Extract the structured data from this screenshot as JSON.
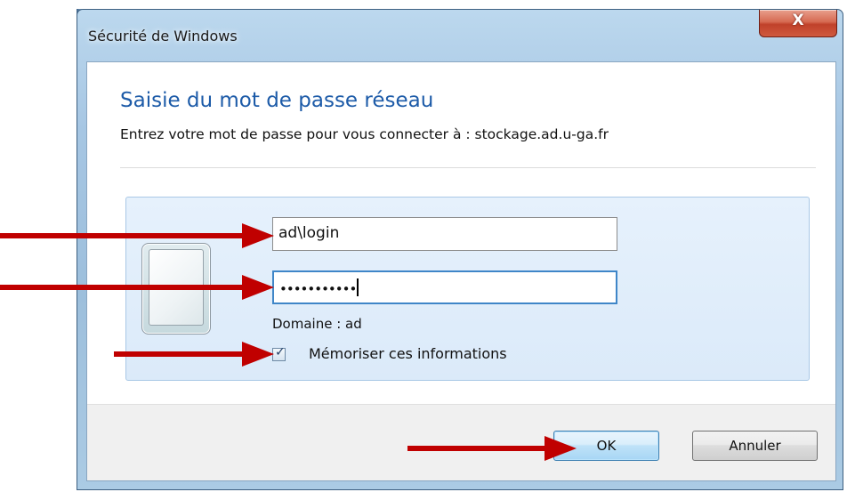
{
  "window": {
    "title": "Sécurité de Windows",
    "close_glyph": "X"
  },
  "dialog": {
    "heading": "Saisie du mot de passe réseau",
    "subheading": "Entrez votre mot de passe pour vous connecter à : stockage.ad.u-ga.fr"
  },
  "credentials": {
    "username_value": "ad\\login",
    "password_value": "•••••••••••",
    "domain_label": "Domaine : ad",
    "remember_checked": true,
    "remember_label": "Mémoriser ces informations"
  },
  "buttons": {
    "ok_label": "OK",
    "cancel_label": "Annuler"
  },
  "colors": {
    "heading": "#1d5ba8",
    "annotation_arrow": "#c00000",
    "close_button": "#c74a33"
  },
  "icons": [
    "close-icon",
    "user-tile-icon",
    "checkmark-icon",
    "arrow-annotation"
  ]
}
